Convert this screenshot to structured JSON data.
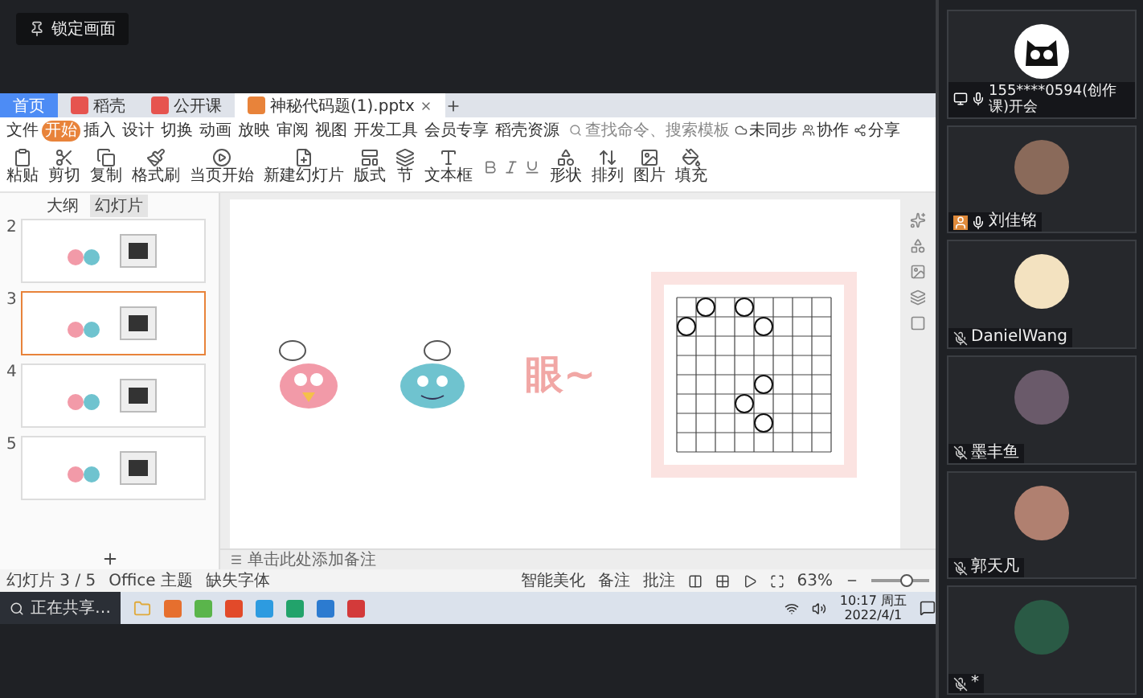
{
  "lock_badge": {
    "label": "锁定画面"
  },
  "wps": {
    "tabs": [
      {
        "label": "首页",
        "kind": "home",
        "selected": false
      },
      {
        "label": "稻壳",
        "kind": "doc",
        "selected": false
      },
      {
        "label": "公开课",
        "kind": "doc",
        "selected": false
      },
      {
        "label": "神秘代码题(1).pptx",
        "kind": "doc",
        "selected": true
      }
    ],
    "menu": [
      {
        "label": "文件",
        "selected": false
      },
      {
        "label": "开始",
        "selected": true
      },
      {
        "label": "插入",
        "selected": false
      },
      {
        "label": "设计",
        "selected": false
      },
      {
        "label": "切换",
        "selected": false
      },
      {
        "label": "动画",
        "selected": false
      },
      {
        "label": "放映",
        "selected": false
      },
      {
        "label": "审阅",
        "selected": false
      },
      {
        "label": "视图",
        "selected": false
      },
      {
        "label": "开发工具",
        "selected": false
      },
      {
        "label": "会员专享",
        "selected": false
      },
      {
        "label": "稻壳资源",
        "selected": false
      }
    ],
    "search": {
      "placeholder": "查找命令、搜索模板"
    },
    "actions": [
      "未同步",
      "协作",
      "分享"
    ],
    "ribbon": [
      "粘贴",
      "剪切",
      "复制",
      "格式刷",
      "当页开始",
      "新建幻灯片",
      "版式",
      "节",
      "文本框",
      "形状",
      "排列",
      "图片",
      "填充"
    ],
    "panel_tabs": [
      {
        "label": "大纲",
        "selected": false
      },
      {
        "label": "幻灯片",
        "selected": true
      }
    ],
    "thumbnails": [
      {
        "number": "2",
        "selected": false
      },
      {
        "number": "3",
        "selected": true
      },
      {
        "number": "4",
        "selected": false
      },
      {
        "number": "5",
        "selected": false
      }
    ],
    "slide": {
      "title": "眼~"
    },
    "notes": {
      "placeholder": "单击此处添加备注"
    },
    "status_left": [
      "幻灯片 3 / 5",
      "Office 主题",
      "缺失字体"
    ],
    "status_right": [
      "智能美化",
      "备注",
      "批注"
    ],
    "zoom": {
      "reading": "63%",
      "level": 0.6
    }
  },
  "taskbar": {
    "search": "正在共享…",
    "time": "10:17 周五",
    "date": "2022/4/1"
  },
  "participants": [
    {
      "name": "155****0594(创作课)开会",
      "muted": false,
      "sharing": true,
      "host": false
    },
    {
      "name": "刘佳铭",
      "muted": false,
      "sharing": false,
      "host": true
    },
    {
      "name": "DanielWang",
      "muted": true,
      "sharing": false,
      "host": false
    },
    {
      "name": "墨丰鱼",
      "muted": true,
      "sharing": false,
      "host": false
    },
    {
      "name": "郭天凡",
      "muted": true,
      "sharing": false,
      "host": false
    },
    {
      "name": "*",
      "muted": true,
      "sharing": false,
      "host": false
    }
  ]
}
